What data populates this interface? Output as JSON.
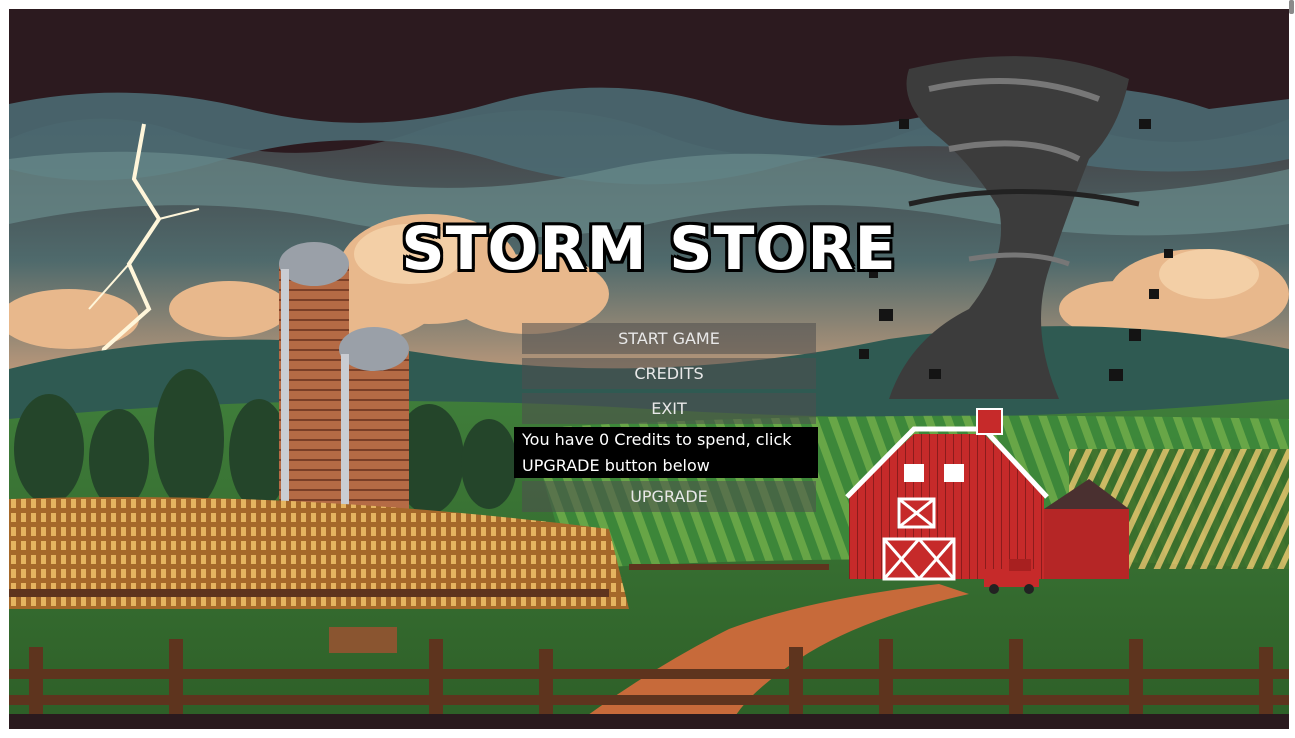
{
  "menu": {
    "title": "STORM STORE",
    "start_label": "START GAME",
    "credits_label": "CREDITS",
    "exit_label": "EXIT",
    "upgrade_label": "UPGRADE"
  },
  "info": {
    "message": "You have 0 Credits to spend, click UPGRADE button below"
  },
  "colors": {
    "button_bg": "rgba(78,78,78,0.55)",
    "info_bg": "#000000",
    "title_fill": "#ffffff",
    "barn_red": "#c62a2a"
  }
}
